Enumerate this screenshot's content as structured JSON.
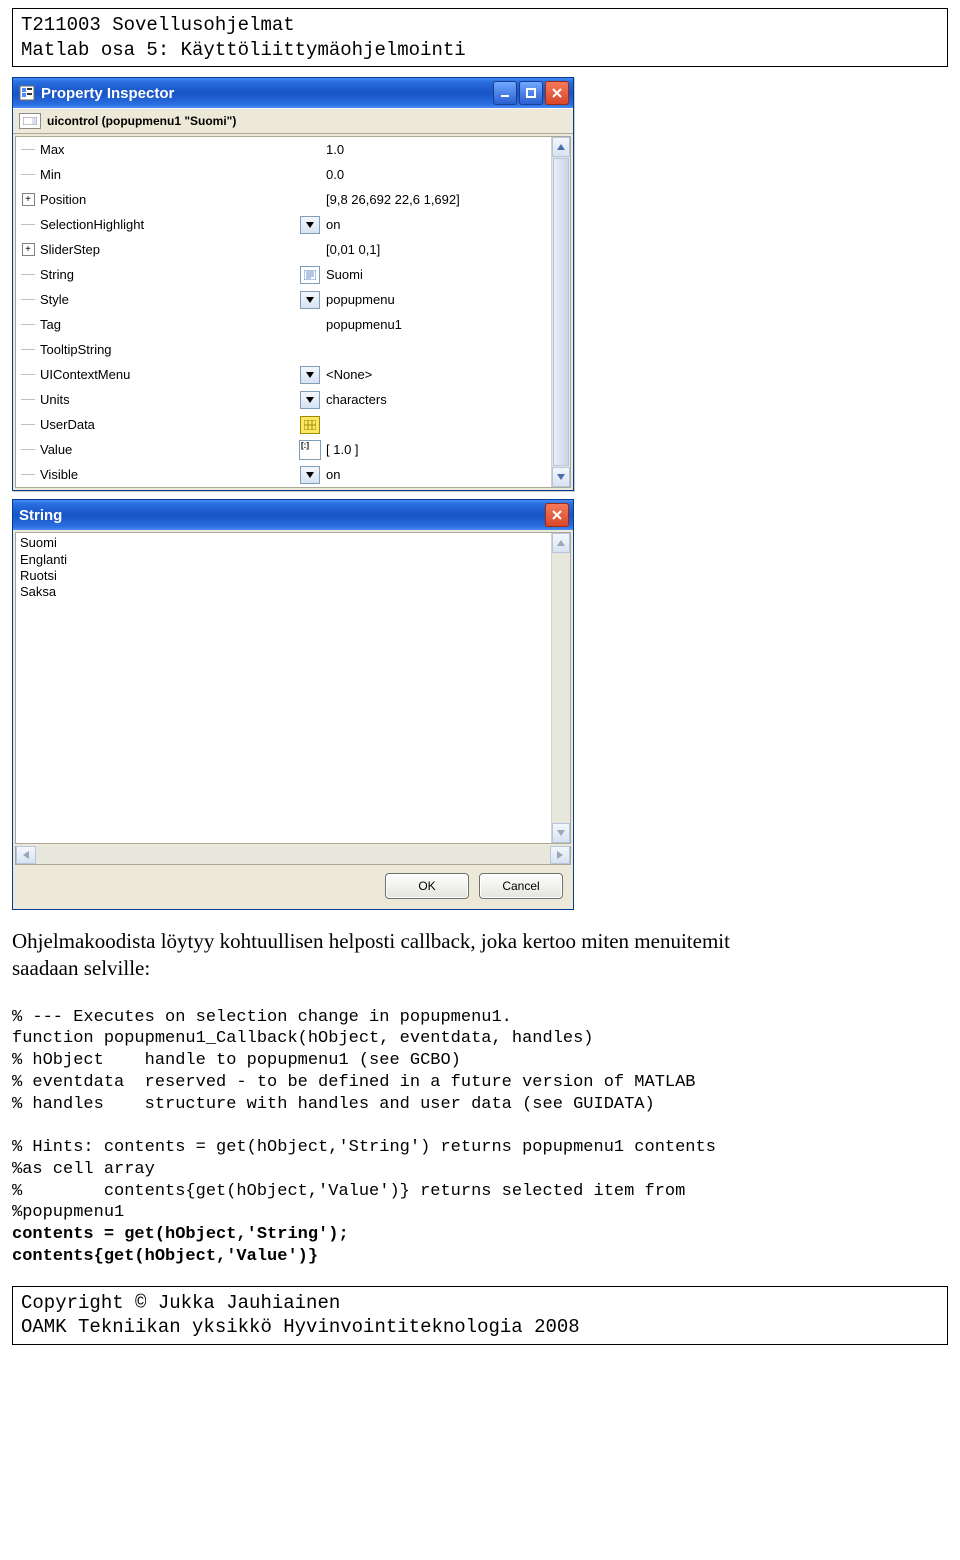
{
  "header": {
    "line1": "T211003 Sovellusohjelmat",
    "line2": "Matlab osa 5: Käyttöliittymäohjelmointi"
  },
  "inspector": {
    "title": "Property Inspector",
    "object_label": "uicontrol (popupmenu1 \"Suomi\")",
    "rows": [
      {
        "exp": "line",
        "name": "Max",
        "icon": "",
        "value": "1.0"
      },
      {
        "exp": "line",
        "name": "Min",
        "icon": "",
        "value": "0.0"
      },
      {
        "exp": "plus",
        "name": "Position",
        "icon": "",
        "value": "[9,8 26,692 22,6 1,692]"
      },
      {
        "exp": "line",
        "name": "SelectionHighlight",
        "icon": "dd",
        "value": "on"
      },
      {
        "exp": "plus",
        "name": "SliderStep",
        "icon": "",
        "value": "[0,01 0,1]"
      },
      {
        "exp": "line",
        "name": "String",
        "icon": "ed",
        "value": "Suomi"
      },
      {
        "exp": "line",
        "name": "Style",
        "icon": "dd",
        "value": "popupmenu"
      },
      {
        "exp": "line",
        "name": "Tag",
        "icon": "",
        "value": "popupmenu1"
      },
      {
        "exp": "line",
        "name": "TooltipString",
        "icon": "",
        "value": ""
      },
      {
        "exp": "line",
        "name": "UIContextMenu",
        "icon": "dd",
        "value": "<None>"
      },
      {
        "exp": "line",
        "name": "Units",
        "icon": "dd",
        "value": "characters"
      },
      {
        "exp": "line",
        "name": "UserData",
        "icon": "grid",
        "value": ""
      },
      {
        "exp": "line",
        "name": "Value",
        "icon": "num",
        "value": "[ 1.0 ]"
      },
      {
        "exp": "line",
        "name": "Visible",
        "icon": "dd",
        "value": "on"
      }
    ]
  },
  "string_editor": {
    "title": "String",
    "lines": [
      "Suomi",
      "Englanti",
      "Ruotsi",
      "Saksa"
    ],
    "ok": "OK",
    "cancel": "Cancel"
  },
  "paragraph": {
    "line1": "Ohjelmakoodista löytyy kohtuullisen helposti callback, joka kertoo miten menuitemit",
    "line2": "saadaan selville:"
  },
  "code": {
    "l1": "% --- Executes on selection change in popupmenu1.",
    "l2": "function popupmenu1_Callback(hObject, eventdata, handles)",
    "l3": "% hObject    handle to popupmenu1 (see GCBO)",
    "l4": "% eventdata  reserved - to be defined in a future version of MATLAB",
    "l5": "% handles    structure with handles and user data (see GUIDATA)",
    "l6": "",
    "l7": "% Hints: contents = get(hObject,'String') returns popupmenu1 contents",
    "l8": "%as cell array",
    "l9": "%        contents{get(hObject,'Value')} returns selected item from",
    "l10": "%popupmenu1",
    "l11": "contents = get(hObject,'String');",
    "l12": "contents{get(hObject,'Value')}"
  },
  "footer": {
    "line1": "Copyright © Jukka Jauhiainen",
    "line2": "OAMK Tekniikan yksikkö Hyvinvointiteknologia 2008"
  }
}
